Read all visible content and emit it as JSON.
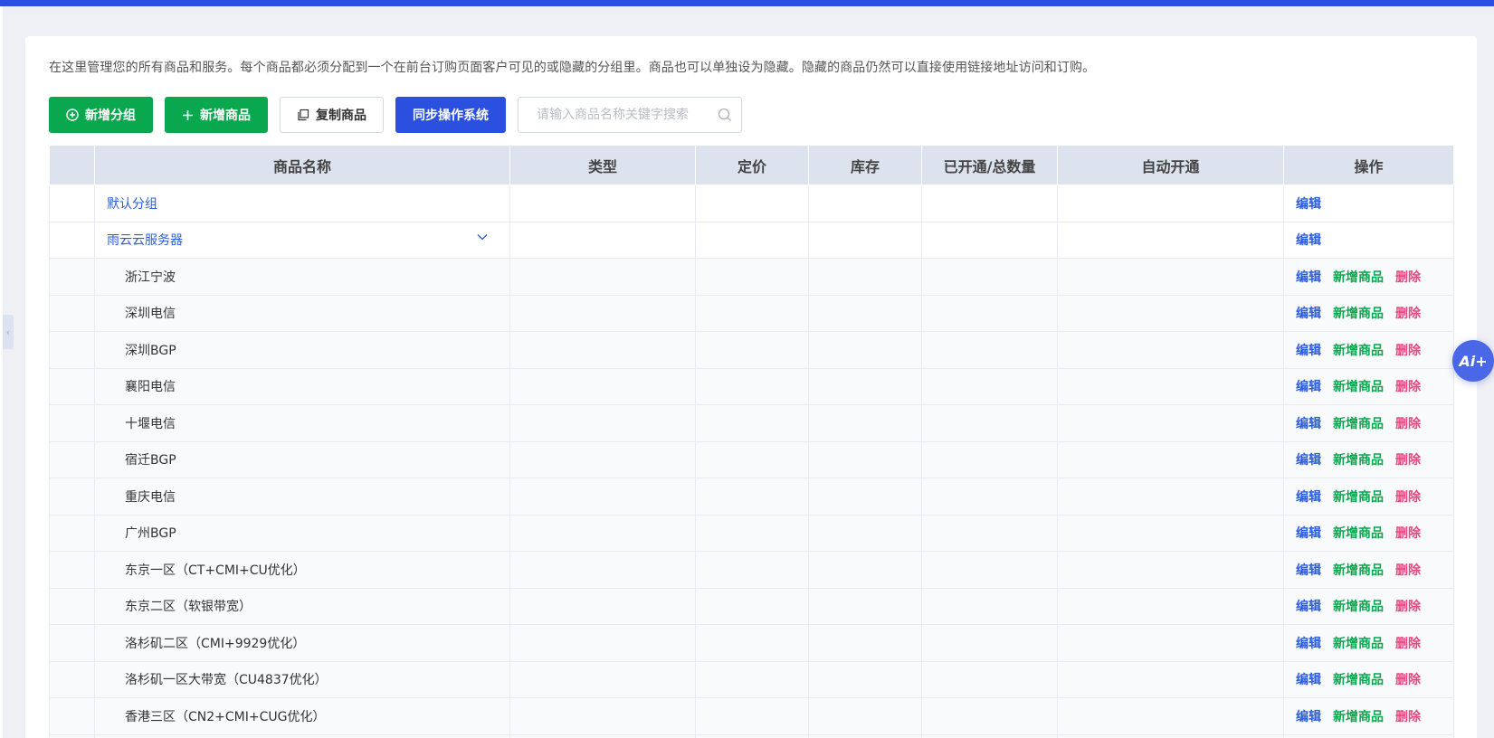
{
  "description": "在这里管理您的所有商品和服务。每个商品都必须分配到一个在前台订购页面客户可见的或隐藏的分组里。商品也可以单独设为隐藏。隐藏的商品仍然可以直接使用链接地址访问和订购。",
  "toolbar": {
    "add_group": "新增分组",
    "add_product": "新增商品",
    "copy_product": "复制商品",
    "sync_os": "同步操作系统",
    "search_placeholder": "请输入商品名称关键字搜索"
  },
  "table": {
    "headers": {
      "name": "商品名称",
      "type": "类型",
      "price": "定价",
      "stock": "库存",
      "opened_total": "已开通/总数量",
      "auto_open": "自动开通",
      "actions": "操作"
    },
    "actions": {
      "edit": "编辑",
      "add_product": "新增商品",
      "delete": "删除"
    },
    "groups": [
      {
        "name": "默认分组"
      },
      {
        "name": "雨云云服务器"
      }
    ],
    "items": [
      {
        "name": "浙江宁波"
      },
      {
        "name": "深圳电信"
      },
      {
        "name": "深圳BGP"
      },
      {
        "name": "襄阳电信"
      },
      {
        "name": "十堰电信"
      },
      {
        "name": "宿迁BGP"
      },
      {
        "name": "重庆电信"
      },
      {
        "name": "广州BGP"
      },
      {
        "name": "东京一区（CT+CMI+CU优化）"
      },
      {
        "name": "东京二区（软银带宽）"
      },
      {
        "name": "洛杉矶二区（CMI+9929优化）"
      },
      {
        "name": "洛杉矶一区大带宽（CU4837优化）"
      },
      {
        "name": "香港三区（CN2+CMI+CUG优化）"
      },
      {
        "name": ""
      }
    ]
  },
  "fab": {
    "label": "Ai+"
  },
  "colors": {
    "primary_blue": "#2b50e0",
    "green": "#0aa84e",
    "danger_pink": "#e8467c",
    "link_blue": "#2b5ce0"
  }
}
